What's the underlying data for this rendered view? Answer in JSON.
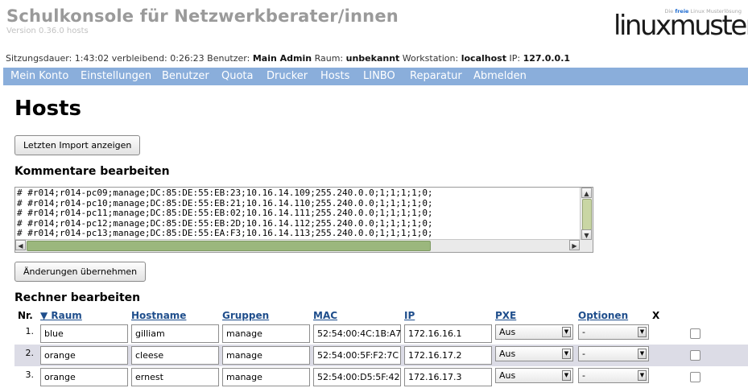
{
  "app": {
    "title": "Schulkonsole für Netzwerkberater/innen",
    "version": "Version 0.36.0 hosts",
    "logo_tagline_prefix": "Die",
    "logo_tagline_free": "freie",
    "logo_tagline_rest": "Linux Musterlösung",
    "logo_word": "linuxmuster"
  },
  "session": {
    "duration_label": "Sitzungsdauer:",
    "duration": "1:43:02",
    "remaining_label": "verbleibend:",
    "remaining": "0:26:23",
    "user_label": "Benutzer:",
    "user": "Main Admin",
    "room_label": "Raum:",
    "room": "unbekannt",
    "workstation_label": "Workstation:",
    "workstation": "localhost",
    "ip_label": "IP:",
    "ip": "127.0.0.1"
  },
  "nav": [
    "Mein Konto",
    "Einstellungen",
    "Benutzer",
    "Quota",
    "Drucker",
    "Hosts",
    "LINBO",
    "Reparatur",
    "Abmelden"
  ],
  "page": {
    "heading": "Hosts",
    "import_button": "Letzten Import anzeigen",
    "comments_heading": "Kommentare bearbeiten",
    "comments_text": "# #r014;r014-pc09;manage;DC:85:DE:55:EB:23;10.16.14.109;255.240.0.0;1;1;1;1;0;\n# #r014;r014-pc10;manage;DC:85:DE:55:EB:21;10.16.14.110;255.240.0.0;1;1;1;1;0;\n# #r014;r014-pc11;manage;DC:85:DE:55:EB:02;10.16.14.111;255.240.0.0;1;1;1;1;0;\n# #r014;r014-pc12;manage;DC:85:DE:55:EB:2D;10.16.14.112;255.240.0.0;1;1;1;1;0;\n# #r014;r014-pc13;manage;DC:85:DE:55:EA:F3;10.16.14.113;255.240.0.0;1;1;1;1;0;",
    "apply_button": "Änderungen übernehmen",
    "hosts_heading": "Rechner bearbeiten"
  },
  "table": {
    "headers": {
      "nr": "Nr.",
      "room": "▼ Raum",
      "hostname": "Hostname",
      "groups": "Gruppen",
      "mac": "MAC",
      "ip": "IP",
      "pxe": "PXE",
      "options": "Optionen",
      "delete": "X"
    },
    "rows": [
      {
        "nr": "1.",
        "room": "blue",
        "hostname": "gilliam",
        "group": "manage",
        "mac": "52:54:00:4C:1B:A7",
        "ip": "172.16.16.1",
        "pxe": "Aus",
        "options": "-"
      },
      {
        "nr": "2.",
        "room": "orange",
        "hostname": "cleese",
        "group": "manage",
        "mac": "52:54:00:5F:F2:7C",
        "ip": "172.16.17.2",
        "pxe": "Aus",
        "options": "-"
      },
      {
        "nr": "3.",
        "room": "orange",
        "hostname": "ernest",
        "group": "manage",
        "mac": "52:54:00:D5:5F:42",
        "ip": "172.16.17.3",
        "pxe": "Aus",
        "options": "-"
      }
    ]
  },
  "colors": {
    "navbar": "#8aaedb",
    "header_link": "#1f4e8c",
    "alt_row": "#dcdce6",
    "title": "#9a9a9a"
  }
}
